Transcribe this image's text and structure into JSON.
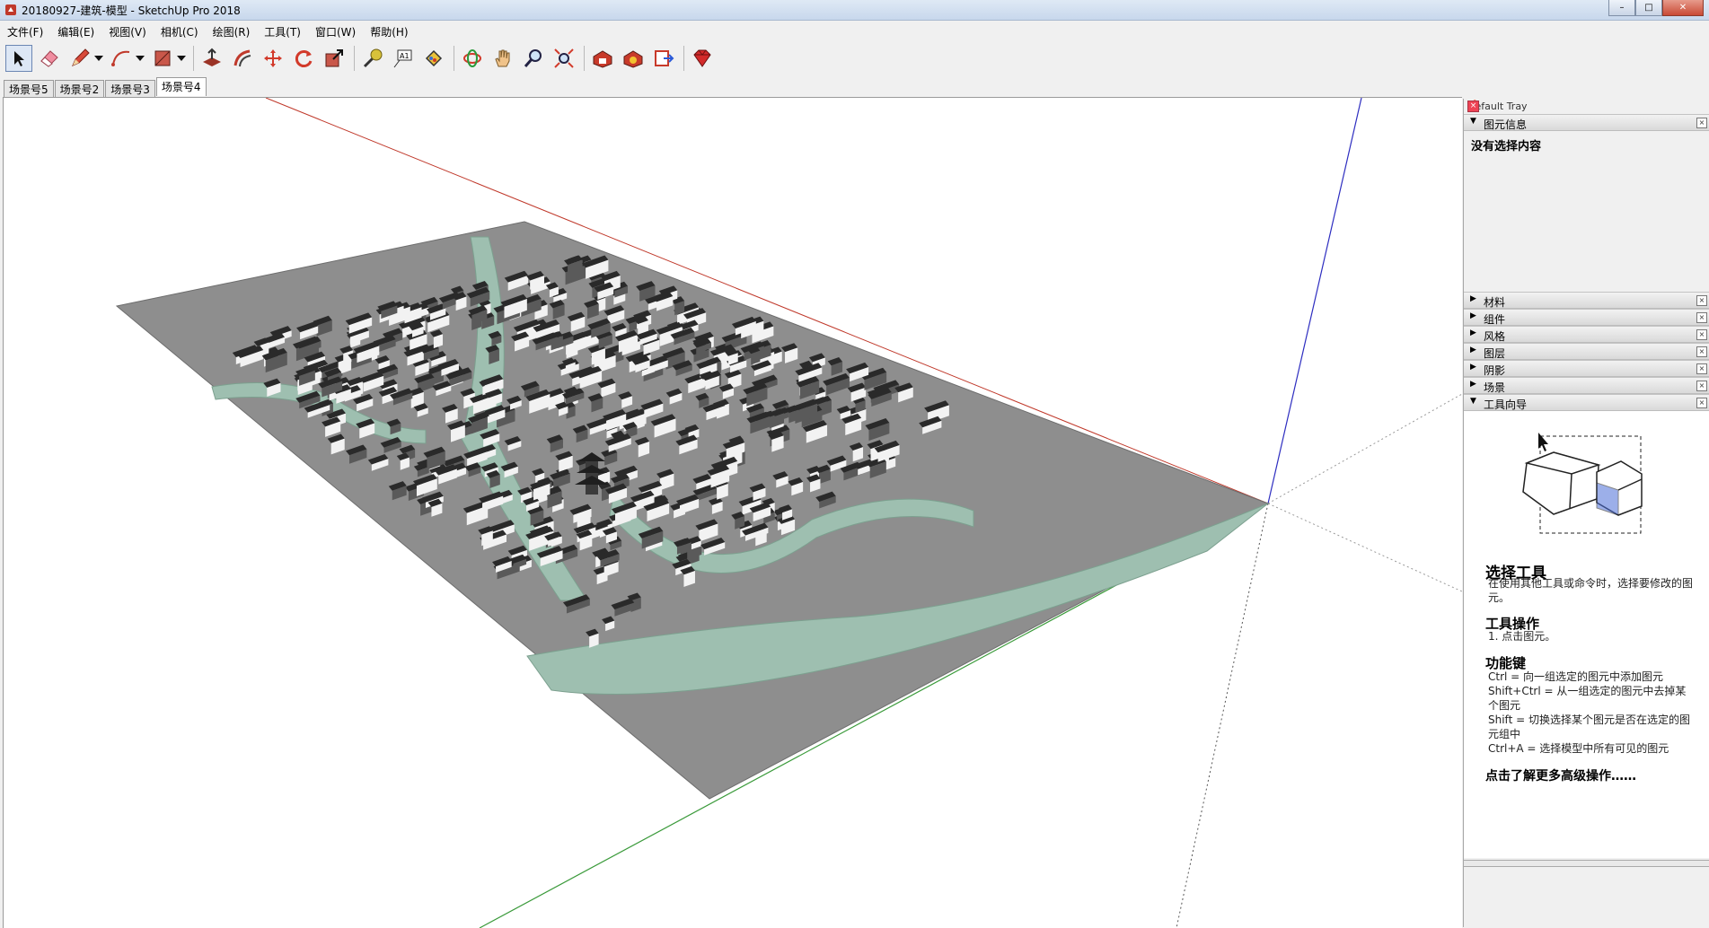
{
  "window": {
    "title": "20180927-建筑-模型 - SketchUp Pro 2018",
    "controls": [
      "–",
      "□",
      "✕"
    ]
  },
  "menu": [
    "文件(F)",
    "编辑(E)",
    "视图(V)",
    "相机(C)",
    "绘图(R)",
    "工具(T)",
    "窗口(W)",
    "帮助(H)"
  ],
  "toolbar": {
    "tools": [
      "select-tool",
      "eraser-tool",
      "line-tool",
      "arc-tool",
      "shape-tool",
      "push-pull-tool",
      "offset-tool",
      "move-tool",
      "rotate-tool",
      "scale-tool",
      "tape-measure-tool",
      "text-tool",
      "paint-bucket-tool",
      "orbit-tool",
      "pan-tool",
      "zoom-tool",
      "zoom-extents-tool",
      "warehouse-tool",
      "extension-warehouse-tool",
      "send-to-layout-tool",
      "ruby-console-tool"
    ]
  },
  "scenes": {
    "tabs": [
      "场景号5",
      "场景号2",
      "场景号3",
      "场景号4"
    ],
    "selected": 3
  },
  "tray": {
    "title": "Default Tray",
    "pin_icon": "pin-icon",
    "entity_info": {
      "label": "图元信息",
      "empty_text": "没有选择内容"
    },
    "collapsed_panels": [
      "材料",
      "组件",
      "风格",
      "图层",
      "阴影",
      "场景"
    ],
    "instructor": {
      "label": "工具向导",
      "tool_name": "选择工具",
      "tool_desc": "在使用其他工具或命令时，选择要修改的图元。",
      "ops_title": "工具操作",
      "ops_text": "1. 点击图元。",
      "keys_title": "功能键",
      "keys": [
        "Ctrl = 向一组选定的图元中添加图元",
        "Shift+Ctrl = 从一组选定的图元中去掉某个图元",
        "Shift = 切换选择某个图元是否在选定的图元组中",
        "Ctrl+A = 选择模型中所有可见的图元"
      ],
      "more_link": "点击了解更多高级操作……"
    }
  },
  "colors": {
    "ground": "#8e8e8e",
    "river": "#9ebfb0",
    "roof": "#2a2a2a",
    "wall": "#f2f2f2",
    "axis_red": "#c0392b",
    "axis_green": "#3a9a3a",
    "axis_blue": "#2d2dc0",
    "selected_tab": "#ffffff"
  }
}
